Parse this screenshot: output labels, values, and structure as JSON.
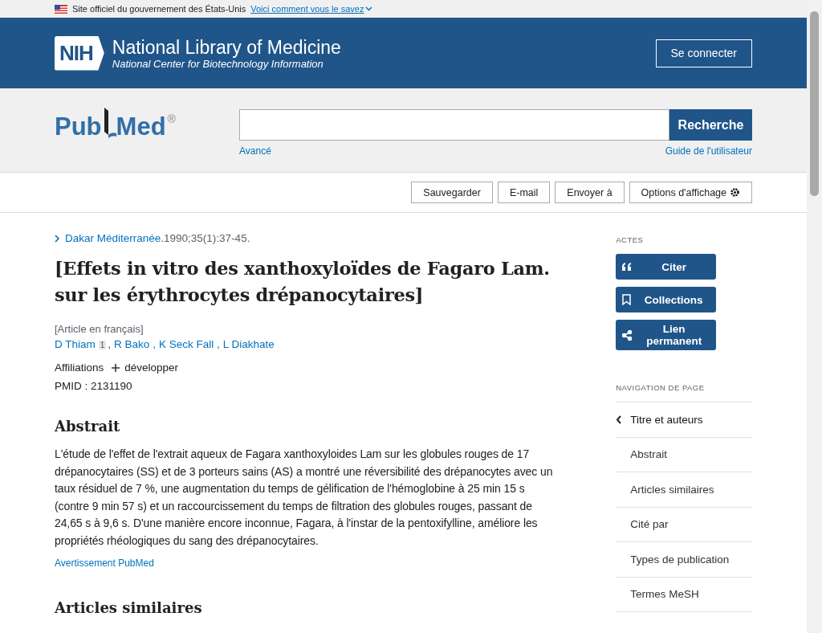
{
  "gov_banner": {
    "text": "Site officiel du gouvernement des États-Unis",
    "link": "Voici comment vous le savez"
  },
  "header": {
    "logo_text": "NIH",
    "title": "National Library of Medicine",
    "subtitle": "National Center for Biotechnology Information",
    "login_button": "Se connecter"
  },
  "search": {
    "logo_left": "Pub",
    "logo_right": "Med",
    "logo_mark": "®",
    "button": "Recherche",
    "advanced_link": "Avancé",
    "guide_link": "Guide de l'utilisateur"
  },
  "toolbar": {
    "buttons": [
      "Sauvegarder",
      "E-mail",
      "Envoyer à",
      "Options d'affichage"
    ]
  },
  "article": {
    "journal_link": "Dakar Méditerranée.",
    "citation": "1990;35(1):37-45.",
    "title": "[Effets in vitro des xanthoxyloïdes de Fagaro Lam. sur les érythrocytes drépanocytaires]",
    "language_note": "[Article en français]",
    "authors": [
      {
        "name": "D Thiam",
        "sup": "1"
      },
      {
        "name": "R Bako"
      },
      {
        "name": "K Seck Fall"
      },
      {
        "name": "L Diakhate"
      }
    ],
    "author_separator": ",",
    "affiliations_label": "Affiliations",
    "expand_link": "développer",
    "pmid": "PMID : 2131190",
    "abstract_heading": "Abstrait",
    "abstract": "L'étude de l'effet de l'extrait aqueux de Fagara xanthoxyloides Lam sur les globules rouges de 17 drépanocytaires (SS) et de 3 porteurs sains (AS) a montré une réversibilité des drépanocytes avec un taux résiduel de 7 %, une augmentation du temps de gélification de l'hémoglobine à 25 min 15 s (contre 9 min 57 s) et un raccourcissement du temps de filtration des globules rouges, passant de 24,65 s à 9,6 s. D'une manière encore inconnue, Fagara, à l'instar de la pentoxifylline, améliore les propriétés rhéologiques du sang des drépanocytaires.",
    "disclaimer_link": "Avertissement PubMed",
    "similar_heading": "Articles similaires"
  },
  "sidebar": {
    "actions_heading": "ACTES",
    "actions": [
      {
        "kind": "quote",
        "label": "Citer"
      },
      {
        "kind": "bookmark",
        "label": "Collections"
      },
      {
        "kind": "share",
        "label": "Lien permanent"
      }
    ],
    "nav_heading": "NAVIGATION DE PAGE",
    "nav_items": [
      {
        "label": "Titre et auteurs",
        "selected": true
      },
      {
        "label": "Abstrait",
        "selected": false
      },
      {
        "label": "Articles similaires",
        "selected": false
      },
      {
        "label": "Cité par",
        "selected": false
      },
      {
        "label": "Types de publication",
        "selected": false
      },
      {
        "label": "Termes MeSH",
        "selected": false
      }
    ]
  }
}
